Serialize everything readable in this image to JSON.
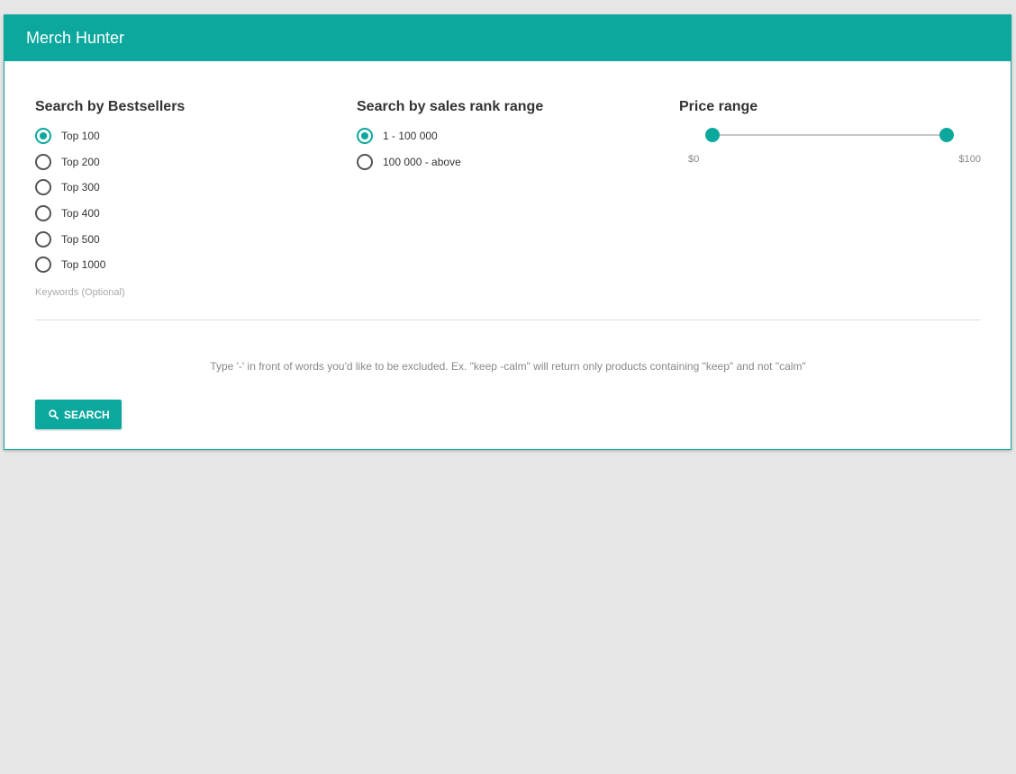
{
  "app": {
    "title": "Merch Hunter"
  },
  "colors": {
    "accent": "#0ca89e",
    "background": "#e5e6e5"
  },
  "bestsellers": {
    "title": "Search by Bestsellers",
    "options": [
      "Top 100",
      "Top 200",
      "Top 300",
      "Top 400",
      "Top 500",
      "Top 1000"
    ],
    "selected": "Top 100"
  },
  "sales_rank": {
    "title": "Search by sales rank range",
    "options": [
      "1 - 100 000",
      "100 000 - above"
    ],
    "selected": "1 - 100 000"
  },
  "price_range": {
    "title": "Price range",
    "min_label": "$0",
    "max_label": "$100",
    "min_value": 0,
    "max_value": 100,
    "low": 0,
    "high": 100
  },
  "keywords": {
    "label": "Keywords (Optional)",
    "value": "",
    "hint": "Type '-' in front of words you'd like to be excluded. Ex. \"keep -calm\" will return only products containing \"keep\" and not \"calm\""
  },
  "search": {
    "label": "SEARCH",
    "icon": "search-icon"
  }
}
